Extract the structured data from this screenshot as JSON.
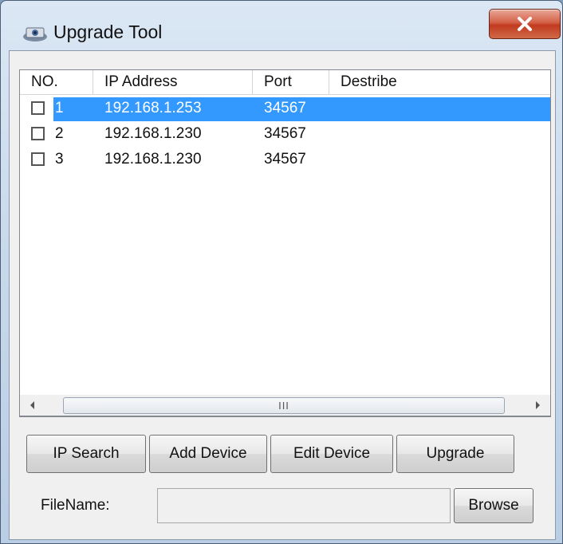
{
  "window": {
    "title": "Upgrade Tool",
    "close_glyph": "X"
  },
  "list": {
    "columns": [
      "NO.",
      "IP Address",
      "Port",
      "Destribe"
    ],
    "rows": [
      {
        "no": "1",
        "ip": "192.168.1.253",
        "port": "34567",
        "describe": "",
        "selected": true
      },
      {
        "no": "2",
        "ip": "192.168.1.230",
        "port": "34567",
        "describe": "",
        "selected": false
      },
      {
        "no": "3",
        "ip": "192.168.1.230",
        "port": "34567",
        "describe": "",
        "selected": false
      }
    ],
    "scroll_grip": "III"
  },
  "buttons": {
    "ip_search": "IP Search",
    "add_device": "Add Device",
    "edit_device": "Edit Device",
    "upgrade": "Upgrade",
    "browse": "Browse"
  },
  "file": {
    "label": "FileName:",
    "value": ""
  },
  "colors": {
    "selection": "#3399ff",
    "close": "#c23a20"
  }
}
